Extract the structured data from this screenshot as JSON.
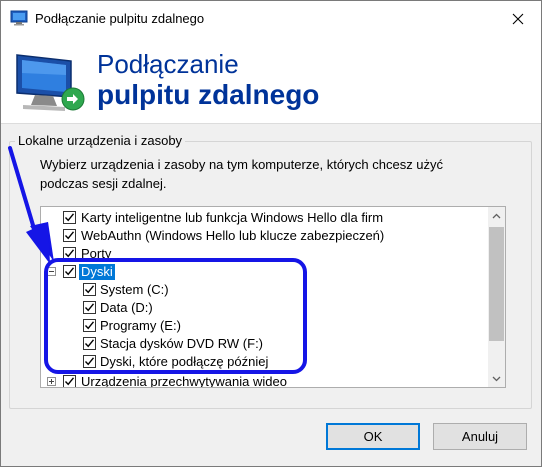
{
  "window": {
    "title": "Podłączanie pulpitu zdalnego",
    "banner_line1": "Podłączanie",
    "banner_line2": "pulpitu zdalnego"
  },
  "group": {
    "legend": "Lokalne urządzenia i zasoby",
    "description": "Wybierz urządzenia i zasoby na tym komputerze, których chcesz użyć podczas sesji zdalnej."
  },
  "tree": {
    "items": [
      {
        "label": "Karty inteligentne lub funkcja Windows Hello dla firm",
        "checked": true
      },
      {
        "label": "WebAuthn (Windows Hello lub klucze zabezpieczeń)",
        "checked": true
      },
      {
        "label": "Porty",
        "checked": true
      },
      {
        "label": "Dyski",
        "checked": true,
        "expanded": true,
        "selected": true
      },
      {
        "label": "System (C:)",
        "checked": true
      },
      {
        "label": "Data (D:)",
        "checked": true
      },
      {
        "label": "Programy (E:)",
        "checked": true
      },
      {
        "label": "Stacja dysków DVD RW (F:)",
        "checked": true
      },
      {
        "label": "Dyski, które podłączę później",
        "checked": true
      },
      {
        "label": "Urządzenia przechwytywania wideo",
        "checked": true,
        "expanded": false
      }
    ]
  },
  "buttons": {
    "ok": "OK",
    "cancel": "Anuluj"
  },
  "colors": {
    "accent": "#0078d7",
    "banner_text": "#003399",
    "annotation": "#1515e6"
  }
}
